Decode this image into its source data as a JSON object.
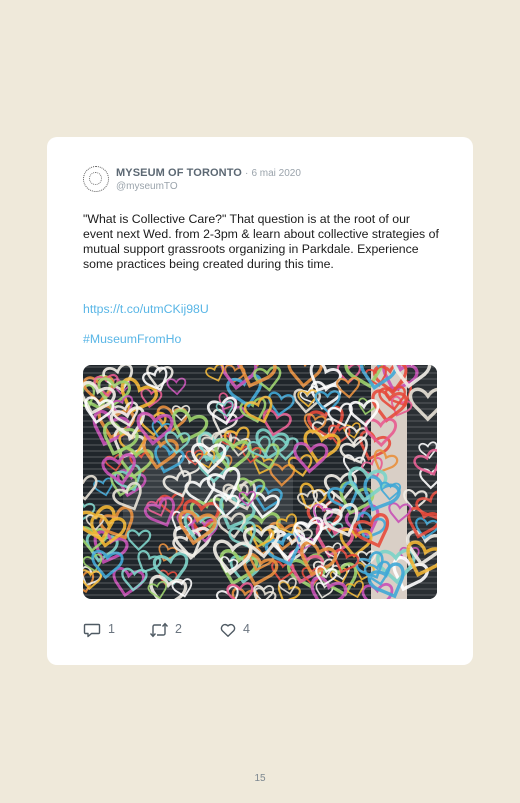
{
  "tweet": {
    "author_name": "MYSEUM OF TORONTO",
    "separator": "·",
    "date": "6 mai 2020",
    "handle": "@myseumTO",
    "body": "\"What is Collective Care?\" That question is at the root of our event next Wed. from 2-3pm & learn about collective strategies of mutual support grassroots organizing in Parkdale. Experience some practices being created during this time.",
    "link": "https://t.co/utmCKij98U",
    "hashtag": "#MuseumFromHo",
    "actions": {
      "reply": {
        "icon": "reply-icon",
        "count": "1"
      },
      "retweet": {
        "icon": "retweet-icon",
        "count": "2"
      },
      "like": {
        "icon": "heart-icon",
        "count": "4"
      }
    }
  },
  "colors": {
    "page_background": "#efe9da",
    "card_background": "#ffffff",
    "link": "#59b6e6",
    "author_name": "#5c6873",
    "meta": "#9aa3ab"
  },
  "page": {
    "number": "15"
  }
}
